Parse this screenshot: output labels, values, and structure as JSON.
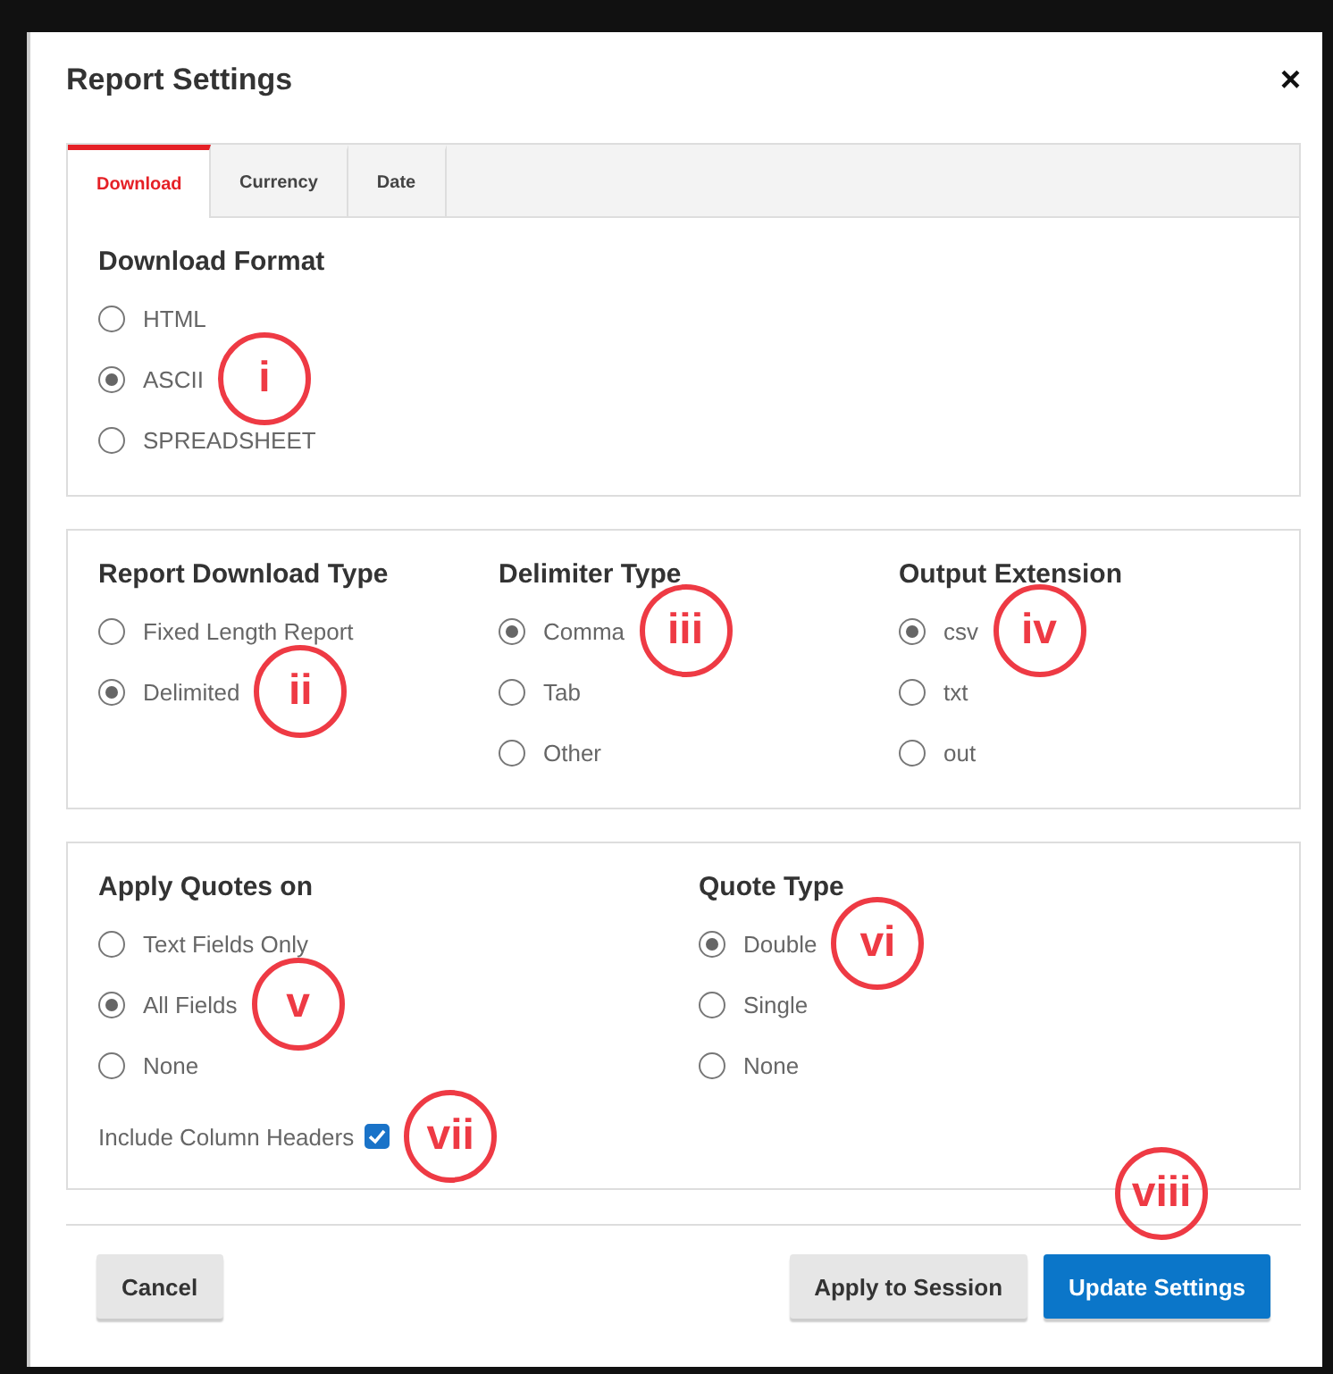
{
  "dialog": {
    "title": "Report Settings",
    "close": "×"
  },
  "tabs": [
    {
      "label": "Download",
      "selected": true
    },
    {
      "label": "Currency",
      "selected": false
    },
    {
      "label": "Date",
      "selected": false
    }
  ],
  "sections": [
    {
      "groups": [
        {
          "heading": "Download Format",
          "options": [
            {
              "label": "HTML",
              "selected": false
            },
            {
              "label": "ASCII",
              "selected": true,
              "callout": "i"
            },
            {
              "label": "SPREADSHEET",
              "selected": false
            }
          ]
        }
      ]
    },
    {
      "groups": [
        {
          "heading": "Report Download Type",
          "options": [
            {
              "label": "Fixed Length Report",
              "selected": false
            },
            {
              "label": "Delimited",
              "selected": true,
              "callout": "ii"
            }
          ]
        },
        {
          "heading": "Delimiter Type",
          "options": [
            {
              "label": "Comma",
              "selected": true,
              "callout": "iii"
            },
            {
              "label": "Tab",
              "selected": false
            },
            {
              "label": "Other",
              "selected": false
            }
          ]
        },
        {
          "heading": "Output Extension",
          "options": [
            {
              "label": "csv",
              "selected": true,
              "callout": "iv"
            },
            {
              "label": "txt",
              "selected": false
            },
            {
              "label": "out",
              "selected": false
            }
          ]
        }
      ]
    },
    {
      "groups": [
        {
          "heading": "Apply Quotes on",
          "options": [
            {
              "label": "Text Fields Only",
              "selected": false
            },
            {
              "label": "All Fields",
              "selected": true,
              "callout": "v"
            },
            {
              "label": "None",
              "selected": false
            }
          ]
        },
        {
          "heading": "Quote Type",
          "options": [
            {
              "label": "Double",
              "selected": true,
              "callout": "vi"
            },
            {
              "label": "Single",
              "selected": false
            },
            {
              "label": "None",
              "selected": false
            }
          ]
        }
      ],
      "checkbox": {
        "label": "Include Column Headers",
        "checked": true,
        "callout": "vii"
      }
    }
  ],
  "buttons": [
    {
      "label": "Cancel",
      "kind": "secondary"
    },
    {
      "label": "Apply to Session",
      "kind": "secondary"
    },
    {
      "label": "Update Settings",
      "kind": "primary",
      "callout": "viii"
    }
  ]
}
